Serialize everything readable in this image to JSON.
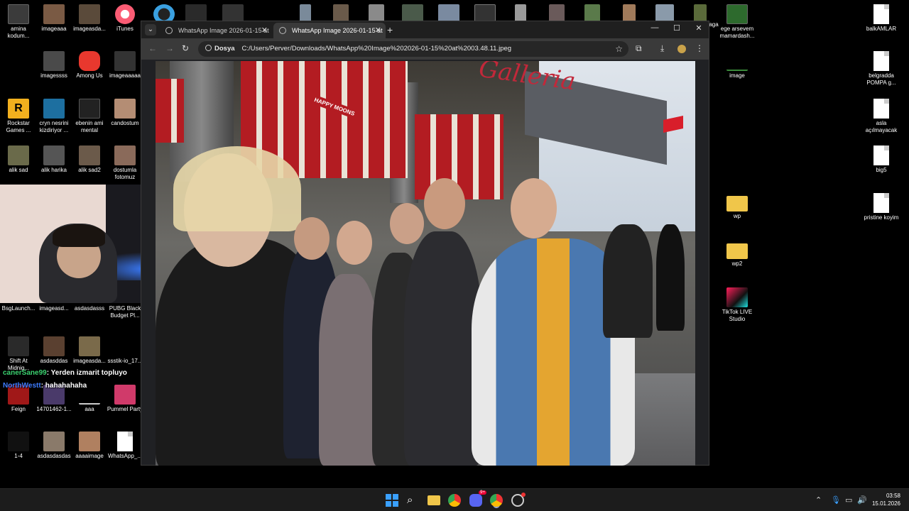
{
  "desktop": {
    "icons_left": [
      {
        "label": "amina kodum...",
        "icon": "video-icon"
      },
      {
        "label": "imageaaa",
        "icon": "image-icon"
      },
      {
        "label": "imageasda...",
        "icon": "image-icon"
      },
      {
        "label": "iTunes",
        "icon": "itunes-icon"
      },
      {
        "label": "imagessss",
        "icon": "image-icon"
      },
      {
        "label": "Among Us",
        "icon": "among-us-icon"
      },
      {
        "label": "imageaaaaa",
        "icon": "image-icon"
      },
      {
        "label": "Rockstar Games ...",
        "icon": "rockstar-icon"
      },
      {
        "label": "cryn nesrini kizdiriyor ...",
        "icon": "video-icon"
      },
      {
        "label": "ebenin ami mental",
        "icon": "video-icon"
      },
      {
        "label": "candostum",
        "icon": "image-icon"
      },
      {
        "label": "alik sad",
        "icon": "image-icon"
      },
      {
        "label": "alik harika",
        "icon": "image-icon"
      },
      {
        "label": "alik sad2",
        "icon": "image-icon"
      },
      {
        "label": "dostumla fotomuz",
        "icon": "image-icon"
      },
      {
        "label": "BsgLaunch...",
        "icon": "app-icon"
      },
      {
        "label": "imageasd...",
        "icon": "image-icon"
      },
      {
        "label": "asdasdasss",
        "icon": "image-icon"
      },
      {
        "label": "PUBG Black Budget Pl...",
        "icon": "pubg-icon"
      },
      {
        "label": "Shift At Midnig...",
        "icon": "game-icon"
      },
      {
        "label": "asdasddas",
        "icon": "image-icon"
      },
      {
        "label": "imageasda...",
        "icon": "image-icon"
      },
      {
        "label": "ssstik-io_17...",
        "icon": "video-icon"
      },
      {
        "label": "Feign",
        "icon": "game-icon"
      },
      {
        "label": "14701462-1...",
        "icon": "image-icon"
      },
      {
        "label": "aaa",
        "icon": "image-icon"
      },
      {
        "label": "Pummel Party",
        "icon": "pummel-party-icon"
      },
      {
        "label": "1-4",
        "icon": "image-icon"
      },
      {
        "label": "asdasdasdas",
        "icon": "image-icon"
      },
      {
        "label": "aaaaimage",
        "icon": "image-icon"
      },
      {
        "label": "WhatsApp_...",
        "icon": "document-icon"
      }
    ],
    "icons_right": [
      {
        "label": "aga",
        "icon": "image-icon"
      },
      {
        "label": "ege arsevem mamardash...",
        "icon": "video-icon"
      },
      {
        "label": "image",
        "icon": "image-icon"
      },
      {
        "label": "wp",
        "icon": "folder-icon"
      },
      {
        "label": "wp2",
        "icon": "folder-icon"
      },
      {
        "label": "TikTok LIVE Studio",
        "icon": "tiktok-icon"
      },
      {
        "label": "balkAMLAR",
        "icon": "document-icon"
      },
      {
        "label": "belgradda POMPA g...",
        "icon": "document-icon"
      },
      {
        "label": "asla açılmayacak",
        "icon": "document-icon"
      },
      {
        "label": "big5",
        "icon": "document-icon"
      },
      {
        "label": "pristine koyim",
        "icon": "document-icon"
      }
    ]
  },
  "browser": {
    "tabs": [
      {
        "title": "WhatsApp Image 2026-01-15 at",
        "active": false
      },
      {
        "title": "WhatsApp Image 2026-01-15 at",
        "active": true
      }
    ],
    "address": {
      "chip": "Dosya",
      "url": "C:/Users/Perver/Downloads/WhatsApp%20Image%202026-01-15%20at%2003.48.11.jpeg"
    },
    "photo_sign": "Galleria",
    "photo_awning_text": "HAPPY MOONS"
  },
  "chat": [
    {
      "user": "canerSane99",
      "message": ": Yerden izmarit topluyo",
      "color": "#3bd16f"
    },
    {
      "user": "NorthWestt",
      "message": ": hahahahaha",
      "color": "#3d7cff"
    }
  ],
  "taskbar": {
    "time": "03:58",
    "date": "15.01.2026",
    "discord_badge": "9+"
  },
  "colors": {
    "accent": "#c2283a",
    "taskbar": "#1c1c1c",
    "window": "#202124"
  }
}
